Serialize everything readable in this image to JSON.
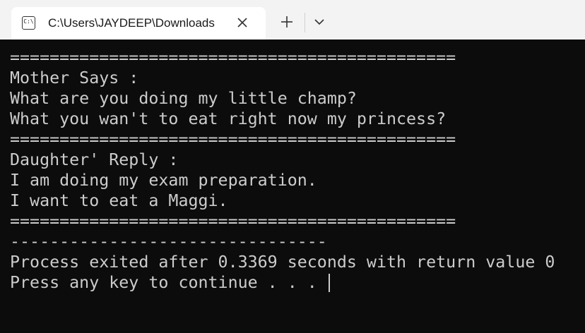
{
  "window": {
    "tab_title": "C:\\Users\\JAYDEEP\\Downloads",
    "tab_icon_text": "C:\\"
  },
  "console": {
    "lines": [
      "=============================================",
      "Mother Says :",
      "What are you doing my little champ?",
      "What you wan't to eat right now my princess?",
      "=============================================",
      "Daughter' Reply :",
      "I am doing my exam preparation.",
      "I want to eat a Maggi.",
      "=============================================",
      "--------------------------------",
      "Process exited after 0.3369 seconds with return value 0",
      "Press any key to continue . . . "
    ]
  },
  "colors": {
    "console_bg": "#0c0c0c",
    "console_fg": "#cccccc",
    "titlebar_bg": "#f3f3f3",
    "tab_bg": "#ffffff"
  },
  "icons": {
    "tab_icon": "console-icon",
    "close": "close-icon",
    "new_tab": "plus-icon",
    "dropdown": "chevron-down-icon"
  }
}
